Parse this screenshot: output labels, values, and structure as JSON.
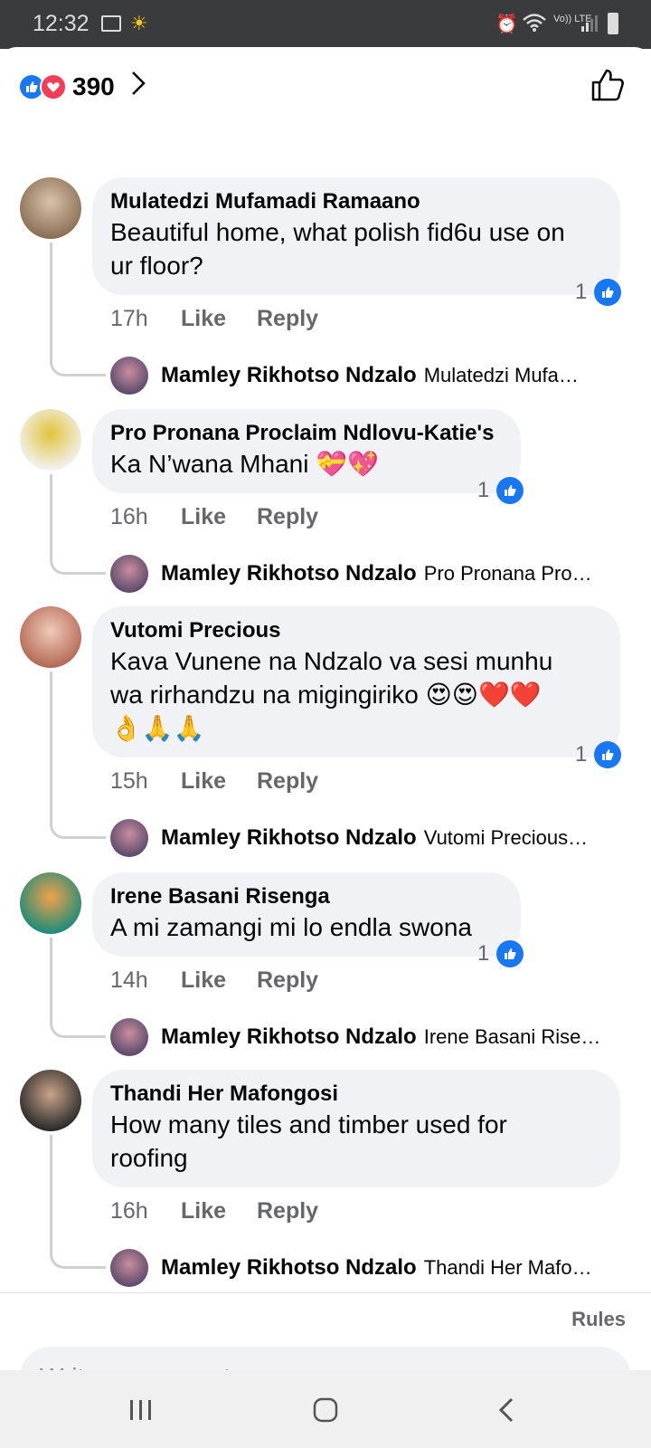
{
  "status_bar": {
    "time": "12:32",
    "lte_label": "Vo)) LTE"
  },
  "header": {
    "reaction_count": "390"
  },
  "comments": [
    {
      "name": "Mulatedzi Mufamadi Ramaano",
      "text_lines": [
        "Beautiful home, what polish fid6u use on",
        "ur floor?"
      ],
      "time": "17h",
      "like_label": "Like",
      "reply_label": "Reply",
      "like_count": "1",
      "reply": {
        "name": "Mamley Rikhotso Ndzalo",
        "preview": "Mulatedzi Mufa…"
      }
    },
    {
      "name": "Pro Pronana Proclaim Ndlovu-Katie's",
      "text_lines": [
        "Ka N’wana Mhani 💝💖"
      ],
      "time": "16h",
      "like_label": "Like",
      "reply_label": "Reply",
      "like_count": "1",
      "reply": {
        "name": "Mamley Rikhotso Ndzalo",
        "preview": "Pro Pronana Pro…"
      }
    },
    {
      "name": "Vutomi Precious",
      "text_lines": [
        "Kava Vunene na Ndzalo va sesi munhu",
        "wa rirhandzu na migingiriko 😍😍❤️❤️",
        "👌🙏🙏"
      ],
      "time": "15h",
      "like_label": "Like",
      "reply_label": "Reply",
      "like_count": "1",
      "reply": {
        "name": "Mamley Rikhotso Ndzalo",
        "preview": "Vutomi Precious…"
      }
    },
    {
      "name": "Irene Basani Risenga",
      "text_lines": [
        "A mi zamangi mi lo endla swona"
      ],
      "time": "14h",
      "like_label": "Like",
      "reply_label": "Reply",
      "like_count": "1",
      "reply": {
        "name": "Mamley Rikhotso Ndzalo",
        "preview": "Irene Basani Rise…"
      }
    },
    {
      "name": "Thandi Her Mafongosi",
      "text_lines": [
        "How many tiles and timber used for",
        "roofing"
      ],
      "time": "16h",
      "like_label": "Like",
      "reply_label": "Reply",
      "like_count": "",
      "reply": {
        "name": "Mamley Rikhotso Ndzalo",
        "preview": "Thandi Her Mafo…"
      }
    }
  ],
  "footer": {
    "rules_label": "Rules",
    "input_placeholder": "Write a comment…"
  },
  "colors": {
    "accent": "#1877f2",
    "love": "#f33e58",
    "bubble": "#f0f2f5",
    "meta_text": "#65676b"
  }
}
